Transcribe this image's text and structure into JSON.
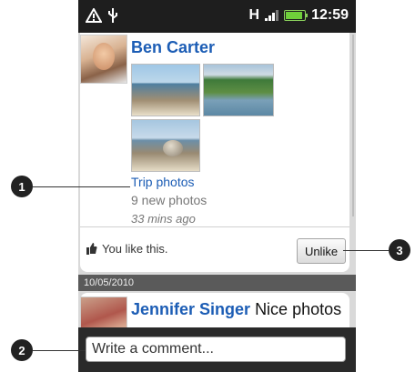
{
  "status_bar": {
    "time": "12:59",
    "network": "H"
  },
  "post": {
    "author": "Ben Carter",
    "album_title": "Trip photos",
    "photo_count": "9 new photos",
    "timestamp": "33 mins ago",
    "like_text": "You like this.",
    "unlike_label": "Unlike"
  },
  "date_header": "10/05/2010",
  "post2": {
    "author": "Jennifer Singer",
    "text": "Nice photos"
  },
  "comment": {
    "placeholder": "Write a comment..."
  },
  "callouts": [
    "1",
    "2",
    "3"
  ]
}
